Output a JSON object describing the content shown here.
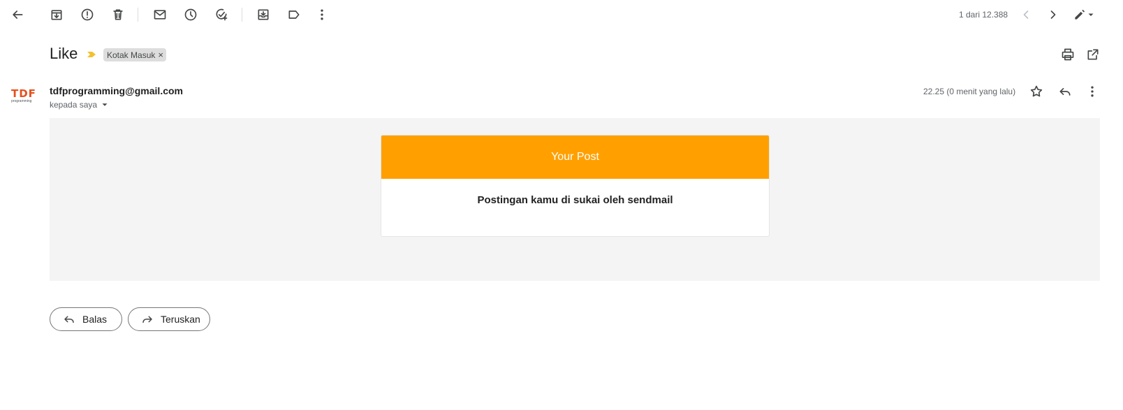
{
  "toolbar": {
    "counter": "1 dari 12.388"
  },
  "email": {
    "subject": "Like",
    "label": "Kotak Masuk",
    "label_remove": "×",
    "sender": "tdfprogramming@gmail.com",
    "recipient": "kepada saya",
    "timestamp": "22.25 (0 menit yang lalu)",
    "avatar_text": "TDF",
    "avatar_subtext": "programming"
  },
  "message": {
    "header": "Your Post",
    "body": "Postingan kamu di sukai oleh sendmail"
  },
  "actions": {
    "reply_label": "Balas",
    "forward_label": "Teruskan"
  },
  "colors": {
    "accent_orange": "#ffa000",
    "importance_marker": "#f2c12e",
    "body_background": "#f4f4f4"
  }
}
